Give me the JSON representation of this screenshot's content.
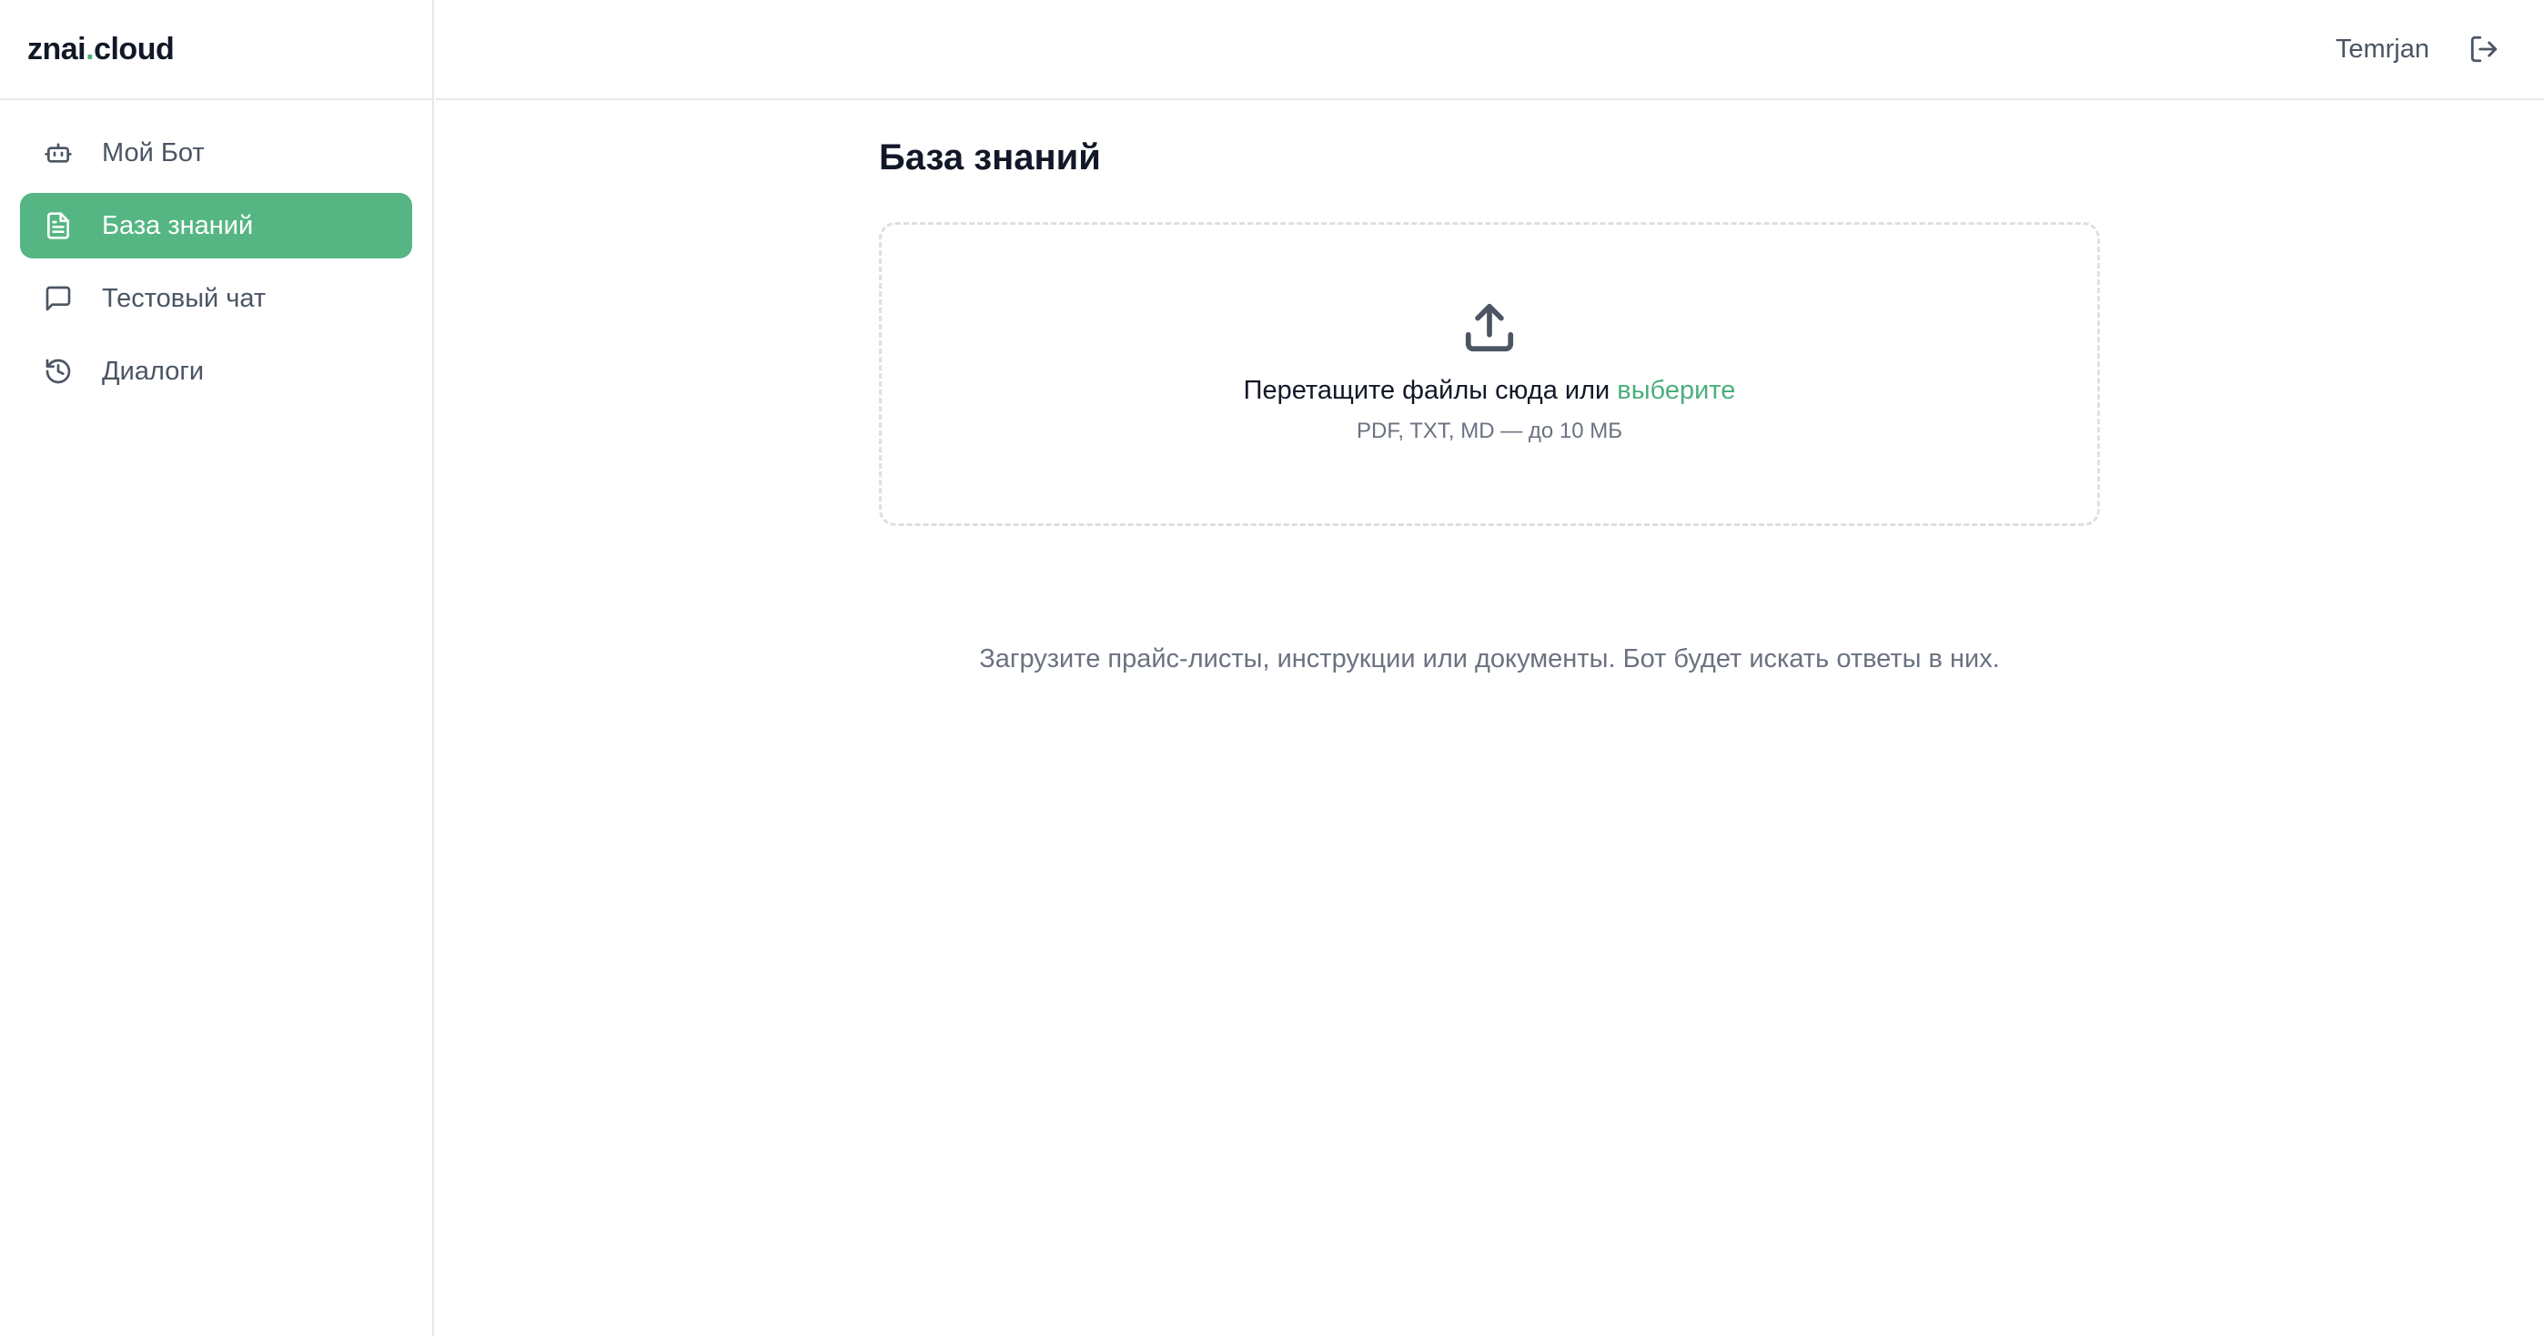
{
  "app": {
    "logo_prefix": "znai",
    "logo_dot": ".",
    "logo_suffix": "cloud"
  },
  "sidebar": {
    "items": [
      {
        "label": "Мой Бот",
        "icon": "bot-icon",
        "active": false
      },
      {
        "label": "База знаний",
        "icon": "document-icon",
        "active": true
      },
      {
        "label": "Тестовый чат",
        "icon": "chat-icon",
        "active": false
      },
      {
        "label": "Диалоги",
        "icon": "history-icon",
        "active": false
      }
    ]
  },
  "header": {
    "username": "Temrjan",
    "logout_icon": "logout-icon"
  },
  "main": {
    "title": "База знаний",
    "dropzone": {
      "icon": "upload-icon",
      "text": "Перетащите файлы сюда или ",
      "link": "выберите",
      "hint": "PDF, TXT, MD — до 10 МБ"
    },
    "empty_text": "Загрузите прайс-листы, инструкции или документы. Бот будет искать ответы в них."
  },
  "colors": {
    "accent": "#55b683",
    "link": "#4caf7d",
    "text_muted": "#6b7280",
    "border": "#e5e7eb"
  }
}
